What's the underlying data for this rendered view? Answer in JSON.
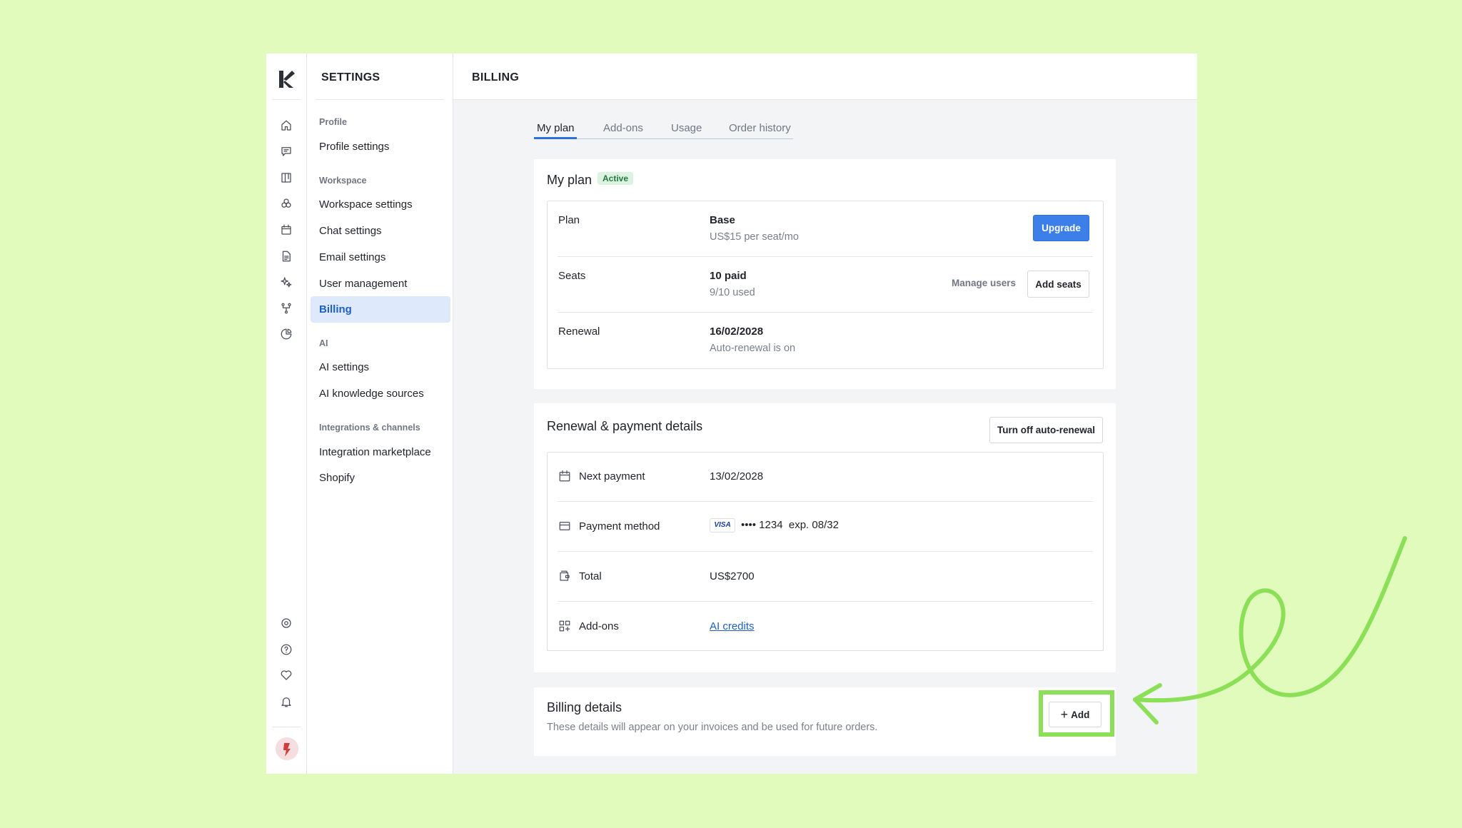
{
  "app": {
    "rail_icons": [
      "home-icon",
      "chat-icon",
      "board-icon",
      "contacts-icon",
      "calendar-icon",
      "document-icon",
      "sparkles-icon",
      "flow-icon",
      "reports-icon"
    ],
    "rail_bottom_icons": [
      "settings-icon",
      "help-icon",
      "heart-icon",
      "bell-icon"
    ]
  },
  "sidebar": {
    "title": "SETTINGS",
    "sections": [
      {
        "label": "Profile",
        "items": [
          "Profile settings"
        ]
      },
      {
        "label": "Workspace",
        "items": [
          "Workspace settings",
          "Chat settings",
          "Email settings",
          "User management",
          "Billing"
        ]
      },
      {
        "label": "AI",
        "items": [
          "AI settings",
          "AI knowledge sources"
        ]
      },
      {
        "label": "Integrations & channels",
        "items": [
          "Integration marketplace",
          "Shopify"
        ]
      }
    ],
    "active_item": "Billing"
  },
  "page": {
    "title": "BILLING",
    "tabs": [
      "My plan",
      "Add-ons",
      "Usage",
      "Order history"
    ],
    "active_tab": "My plan"
  },
  "plan_card": {
    "title": "My plan",
    "badge": "Active",
    "rows": {
      "plan": {
        "label": "Plan",
        "value": "Base",
        "sub": "US$15 per seat/mo",
        "action": "Upgrade"
      },
      "seats": {
        "label": "Seats",
        "value": "10 paid",
        "sub": "9/10 used",
        "secondary_action": "Manage users",
        "action": "Add seats"
      },
      "renewal": {
        "label": "Renewal",
        "value": "16/02/2028",
        "sub": "Auto-renewal is on"
      }
    }
  },
  "renewal_card": {
    "title": "Renewal & payment details",
    "action": "Turn off auto-renewal",
    "rows": {
      "next_payment": {
        "label": "Next payment",
        "value": "13/02/2028"
      },
      "payment_method": {
        "label": "Payment method",
        "card_brand": "VISA",
        "value": "•••• 1234  exp. 08/32"
      },
      "total": {
        "label": "Total",
        "value": "US$2700"
      },
      "addons": {
        "label": "Add-ons",
        "value": "AI credits"
      }
    }
  },
  "billing_card": {
    "title": "Billing details",
    "description": "These details will appear on your invoices and be used for future orders.",
    "action": "Add"
  },
  "colors": {
    "background": "#e1fbbd",
    "accent": "#3d7fe8",
    "highlight": "#8ce057",
    "active_badge": "#ddf3e2"
  }
}
